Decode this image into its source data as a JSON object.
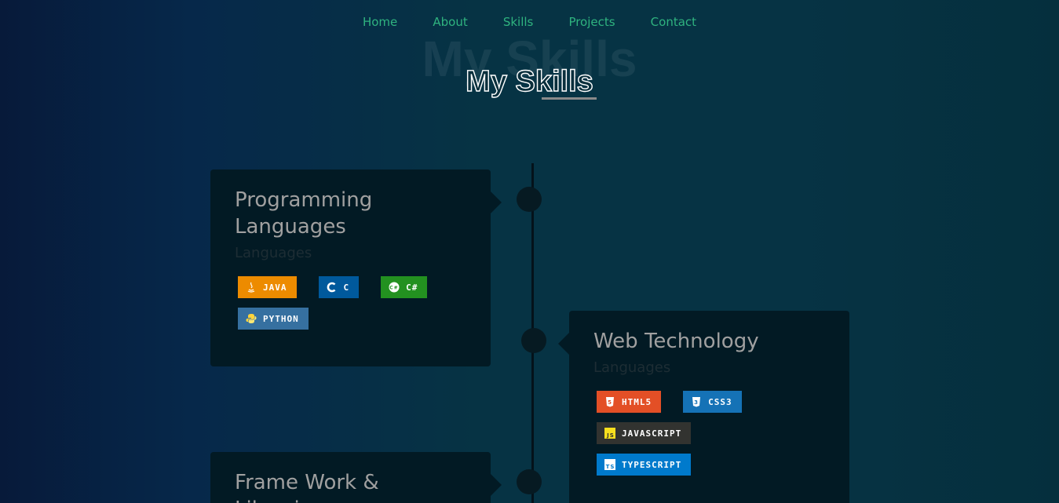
{
  "nav": {
    "items": [
      "Home",
      "About",
      "Skills",
      "Projects",
      "Contact"
    ]
  },
  "section": {
    "background_title": "My Skills",
    "title": "My Skills"
  },
  "cards": [
    {
      "title": "Programming Languages",
      "subtitle": "Languages",
      "badges": [
        {
          "label": "JAVA",
          "icon": "java-icon",
          "color": "#ED8B00"
        },
        {
          "label": "C",
          "icon": "c-icon",
          "color": "#00599C"
        },
        {
          "label": "C#",
          "icon": "csharp-icon",
          "color": "#239120"
        },
        {
          "label": "PYTHON",
          "icon": "python-icon",
          "color": "#3670A0"
        }
      ]
    },
    {
      "title": "Web Technology",
      "subtitle": "Languages",
      "badges": [
        {
          "label": "HTML5",
          "icon": "html5-icon",
          "color": "#E34F26"
        },
        {
          "label": "CSS3",
          "icon": "css3-icon",
          "color": "#1572B6"
        },
        {
          "label": "JAVASCRIPT",
          "icon": "javascript-icon",
          "color": "#323330"
        },
        {
          "label": "TYPESCRIPT",
          "icon": "typescript-icon",
          "color": "#007ACC"
        }
      ]
    },
    {
      "title": "Frame Work & Libraries",
      "subtitle": "",
      "badges": []
    }
  ],
  "colors": {
    "nav_link": "#2fb37f",
    "card_bg": "#021a24",
    "card_title": "#a0a0a0"
  }
}
